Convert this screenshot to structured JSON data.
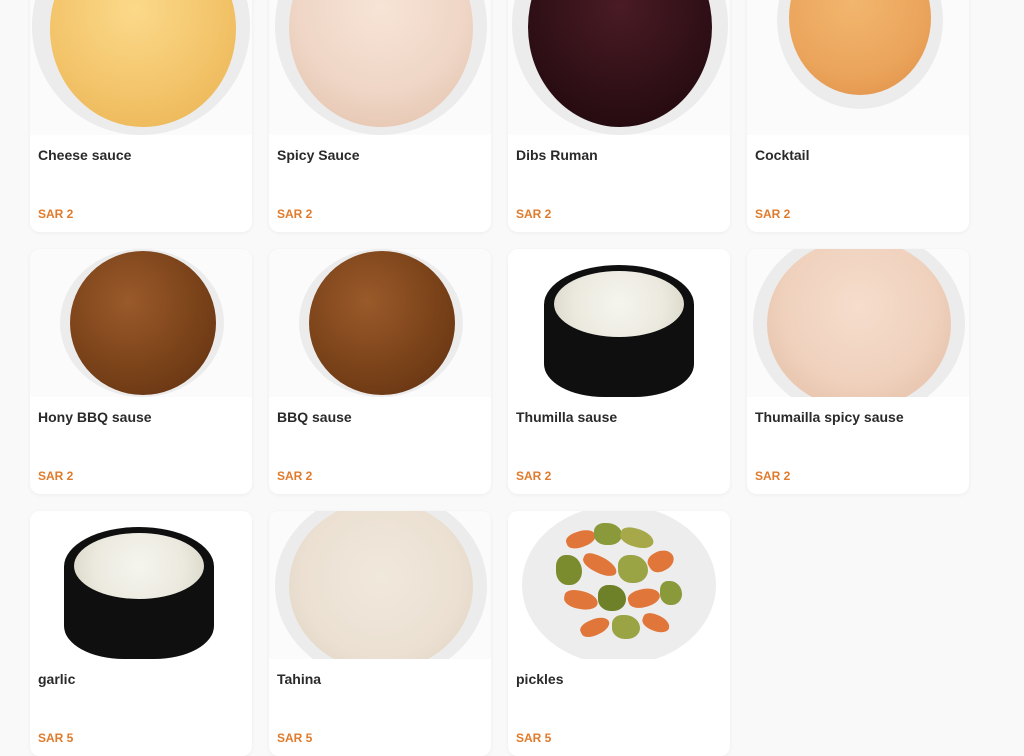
{
  "products": [
    {
      "name": "Cheese sauce",
      "price": "SAR 2",
      "image": "cheese-sauce-image",
      "color": "#f3c46a"
    },
    {
      "name": "Spicy Sauce",
      "price": "SAR 2",
      "image": "spicy-sauce-image",
      "color": "#efd6c6"
    },
    {
      "name": "Dibs Ruman",
      "price": "SAR 2",
      "image": "dibs-ruman-image",
      "color": "#2e0f15"
    },
    {
      "name": "Cocktail",
      "price": "SAR 2",
      "image": "cocktail-sauce-image",
      "color": "#eba45b"
    },
    {
      "name": "Hony BBQ sause",
      "price": "SAR 2",
      "image": "honey-bbq-sauce-image",
      "color": "#7a4219"
    },
    {
      "name": "BBQ sause",
      "price": "SAR 2",
      "image": "bbq-sauce-image",
      "color": "#7a4219"
    },
    {
      "name": "Thumilla sause",
      "price": "SAR 2",
      "image": "thumilla-sauce-image",
      "color": "#eceadf"
    },
    {
      "name": "Thumailla spicy sause",
      "price": "SAR 2",
      "image": "thumailla-spicy-sauce-image",
      "color": "#efd1bd"
    },
    {
      "name": "garlic",
      "price": "SAR 5",
      "image": "garlic-sauce-image",
      "color": "#eceadf"
    },
    {
      "name": "Tahina",
      "price": "SAR 5",
      "image": "tahina-image",
      "color": "#ebe0d2"
    },
    {
      "name": "pickles",
      "price": "SAR 5",
      "image": "pickles-image",
      "color": "#8a9a3a"
    }
  ]
}
